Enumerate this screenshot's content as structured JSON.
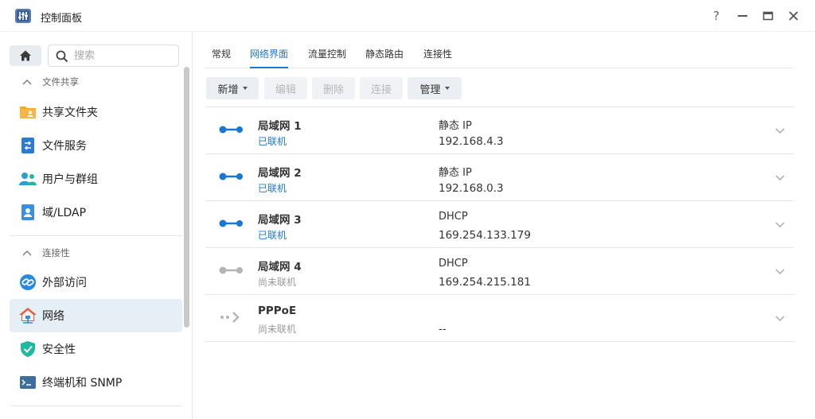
{
  "app": {
    "title": "控制面板"
  },
  "window_controls": {
    "help": "?"
  },
  "sidebar": {
    "search_placeholder": "搜索",
    "sections": [
      {
        "label": "文件共享"
      },
      {
        "label": "连接性"
      }
    ],
    "items": [
      {
        "label": "共享文件夹",
        "icon": "shared-folder-icon"
      },
      {
        "label": "文件服务",
        "icon": "file-services-icon"
      },
      {
        "label": "用户与群组",
        "icon": "user-group-icon"
      },
      {
        "label": "域/LDAP",
        "icon": "domain-ldap-icon"
      },
      {
        "label": "外部访问",
        "icon": "external-access-icon"
      },
      {
        "label": "网络",
        "icon": "network-icon",
        "active": true
      },
      {
        "label": "安全性",
        "icon": "security-shield-icon"
      },
      {
        "label": "终端机和 SNMP",
        "icon": "terminal-icon"
      }
    ]
  },
  "tabs": [
    {
      "label": "常规"
    },
    {
      "label": "网络界面",
      "active": true
    },
    {
      "label": "流量控制"
    },
    {
      "label": "静态路由"
    },
    {
      "label": "连接性"
    }
  ],
  "toolbar": {
    "create": "新增",
    "edit": "编辑",
    "delete": "删除",
    "connect": "连接",
    "manage": "管理"
  },
  "interfaces": [
    {
      "name": "局域网 1",
      "status": "已联机",
      "connected": true,
      "type": "静态 IP",
      "ip": "192.168.4.3"
    },
    {
      "name": "局域网 2",
      "status": "已联机",
      "connected": true,
      "type": "静态 IP",
      "ip": "192.168.0.3"
    },
    {
      "name": "局域网 3",
      "status": "已联机",
      "connected": true,
      "type": "DHCP",
      "ip": "169.254.133.179"
    },
    {
      "name": "局域网 4",
      "status": "尚未联机",
      "connected": false,
      "type": "DHCP",
      "ip": "169.254.215.181"
    },
    {
      "name": "PPPoE",
      "status": "尚未联机",
      "connected": false,
      "type": "",
      "ip": "--"
    }
  ],
  "colors": {
    "accent": "#1a77d2",
    "connected": "#1a77d2",
    "disconnected": "#b5b5b5"
  }
}
